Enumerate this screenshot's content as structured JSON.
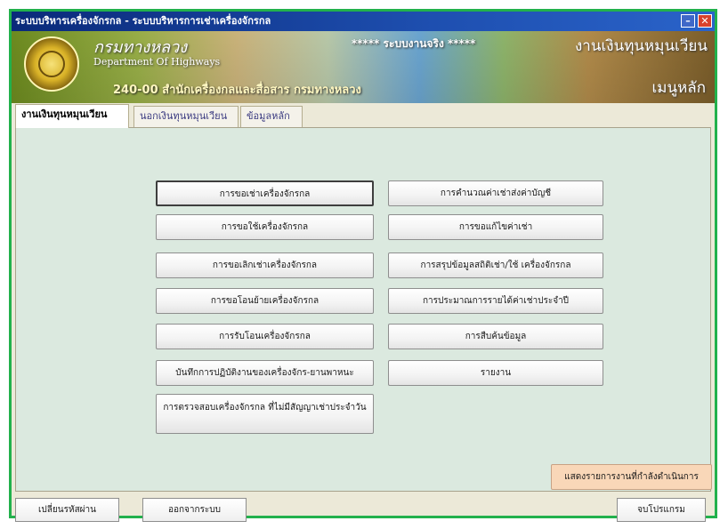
{
  "window": {
    "title": "ระบบบริหารเครื่องจักรกล - ระบบบริหารการเช่าเครื่องจักรกล",
    "minimize_glyph": "–",
    "close_glyph": "✕"
  },
  "banner": {
    "dept_th": "กรมทางหลวง",
    "dept_en": "Department Of Highways",
    "office": "240-00 สำนักเครื่องกลและสื่อสาร กรมทางหลวง",
    "system_mode": "***** ระบบงานจริง *****",
    "right_title": "งานเงินทุนหมุนเวียน",
    "right_subtitle": "เมนูหลัก"
  },
  "tabs": [
    {
      "label": "งานเงินทุนหมุนเวียน"
    },
    {
      "label": "นอกเงินทุนหมุนเวียน"
    },
    {
      "label": "ข้อมูลหลัก"
    }
  ],
  "menu": {
    "left": [
      "การขอเช่าเครื่องจักรกล",
      "การขอใช้เครื่องจักรกล",
      "การขอเลิกเช่าเครื่องจักรกล",
      "การขอโอนย้ายเครื่องจักรกล",
      "การรับโอนเครื่องจักรกล",
      "บันทึกการปฏิบัติงานของเครื่องจักร-ยานพาหนะ",
      "การตรวจสอบเครื่องจักรกล ที่ไม่มีสัญญาเช่าประจำวัน"
    ],
    "right": [
      "การคำนวณค่าเช่าส่งค่าบัญชี",
      "การขอแก้ไขค่าเช่า",
      "การสรุปข้อมูลสถิติเช่า/ใช้ เครื่องจักรกล",
      "การประมาณการรายได้ค่าเช่าประจำปี",
      "การสืบค้นข้อมูล",
      "รายงาน"
    ],
    "progress": "แสดงรายการงานที่กำลังดำเนินการ"
  },
  "footer": {
    "change_password": "เปลี่ยนรหัสผ่าน",
    "logout": "ออกจากระบบ",
    "close_program": "จบโปรแกรม"
  },
  "colors": {
    "window_border": "#22b14c",
    "panel_bg": "#dbe9df",
    "progress_button": "#f9d7b8"
  }
}
